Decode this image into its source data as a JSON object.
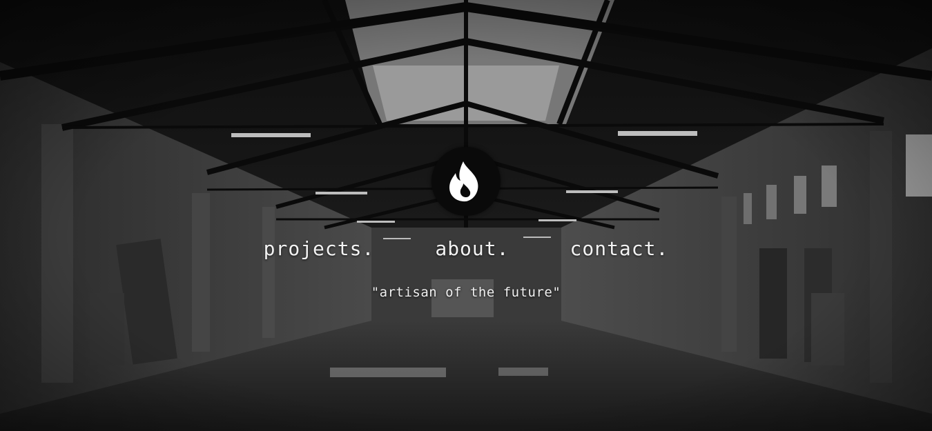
{
  "hero": {
    "background_image": "abandoned-warehouse-photo",
    "tint": "grayscale"
  },
  "logo": {
    "icon": "flame-icon",
    "bg_color": "#0a0a0a",
    "icon_color": "#ffffff"
  },
  "nav": {
    "items": [
      {
        "label": "projects."
      },
      {
        "label": "about."
      },
      {
        "label": "contact."
      }
    ]
  },
  "tagline": "\"artisan of the future\""
}
